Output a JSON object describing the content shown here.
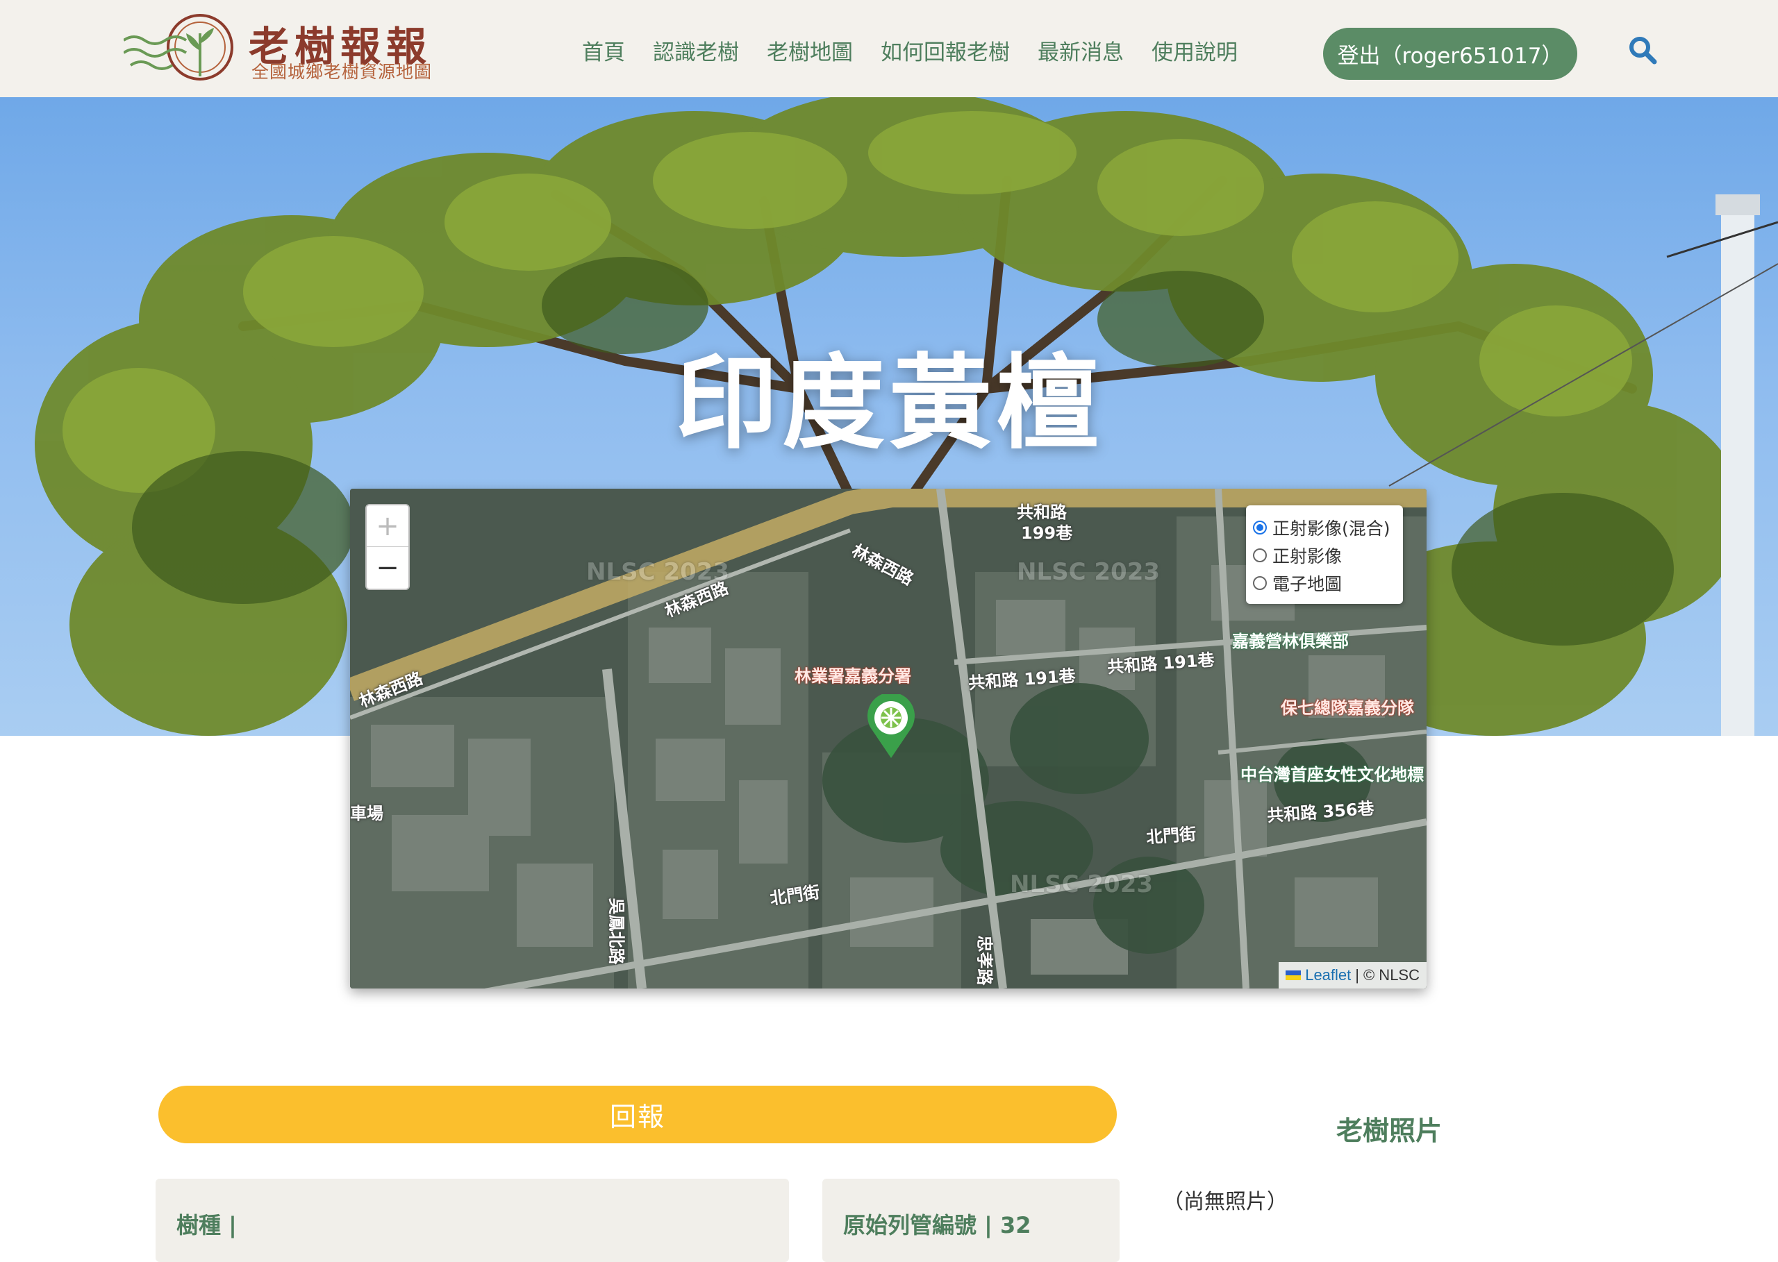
{
  "header": {
    "logo_title": "老樹報報",
    "logo_subtitle": "全國城鄉老樹資源地圖",
    "nav": [
      "首頁",
      "認識老樹",
      "老樹地圖",
      "如何回報老樹",
      "最新消息",
      "使用說明"
    ],
    "logout_label": "登出（roger651017）"
  },
  "hero": {
    "title": "印度黃檀"
  },
  "map": {
    "zoom_in": "+",
    "zoom_out": "−",
    "layers": [
      {
        "label": "正射影像(混合)",
        "selected": true
      },
      {
        "label": "正射影像",
        "selected": false
      },
      {
        "label": "電子地圖",
        "selected": false
      }
    ],
    "attribution": {
      "leaflet": "Leaflet",
      "separator": "|",
      "source": "© NLSC"
    },
    "labels": {
      "l1": "共和路",
      "l2": "199巷",
      "l3": "林森西路",
      "l4": "林森西路",
      "l5": "林森西路",
      "l6": "林業署嘉義分署",
      "l7": "共和路 191巷",
      "l8": "共和路 191巷",
      "l9": "嘉義營林俱樂部",
      "l10": "保七總隊嘉義分隊",
      "l11": "中台灣首座女性文化地標",
      "l12": "共和路 356巷",
      "l13": "北門街",
      "l14": "北門街",
      "l15": "吳鳳北路",
      "l16": "忠孝路",
      "l17": "車場",
      "wm1": "NLSC 2023",
      "wm2": "NLSC 2023",
      "wm3": "NLSC 2023"
    },
    "colors": {
      "marker": "#3aa04a",
      "road_major": "#e8c874"
    }
  },
  "content": {
    "report_label": "回報",
    "photo_title": "老樹照片",
    "no_photo": "（尚無照片）",
    "species_label": "樹種 |",
    "serial_label": "原始列管編號 | 32"
  },
  "colors": {
    "brand_green": "#5b8c66",
    "nav_text": "#4e7e5d",
    "report_yellow": "#fbbf2d",
    "logo_red": "#8c3b2c"
  }
}
